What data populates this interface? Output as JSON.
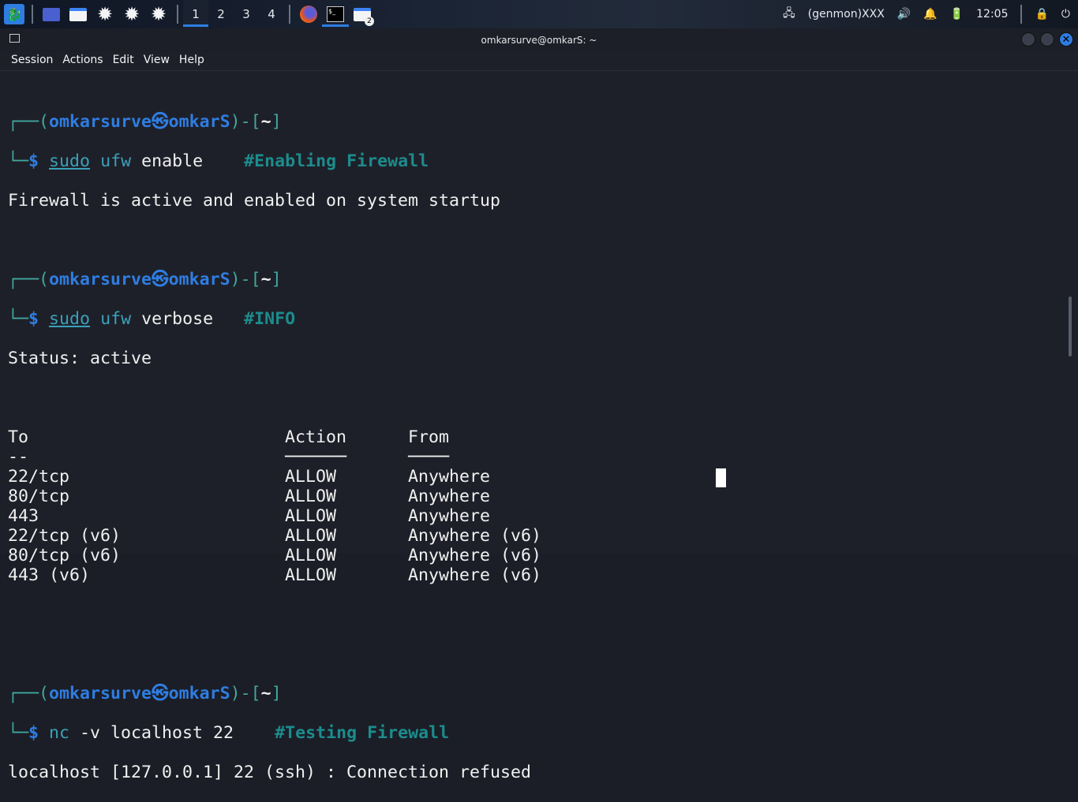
{
  "panel": {
    "workspaces": [
      "1",
      "2",
      "3",
      "4"
    ],
    "genmon": "(genmon)XXX",
    "clock": "12:05",
    "badge": "2"
  },
  "window": {
    "title": "omkarsurve@omkarS: ~",
    "menu": [
      "Session",
      "Actions",
      "Edit",
      "View",
      "Help"
    ]
  },
  "prompt": {
    "user": "omkarsurve",
    "at": "㉿",
    "host": "omkarS",
    "dir": "~"
  },
  "commands": [
    {
      "sudo": "sudo",
      "cmd": "ufw",
      "args": " enable    ",
      "comment": "#Enabling Firewall",
      "output": [
        "Firewall is active and enabled on system startup"
      ]
    },
    {
      "sudo": "sudo",
      "cmd": "ufw",
      "args": " verbose   ",
      "comment": "#INFO",
      "output": [
        "Status: active"
      ]
    },
    {
      "cmd": "nc",
      "args": " -v localhost 22    ",
      "comment": "#Testing Firewall",
      "output": [
        "localhost [127.0.0.1] 22 (ssh) : Connection refused"
      ]
    }
  ],
  "table": {
    "headers": [
      "To",
      "Action",
      "From"
    ],
    "underline": [
      "--",
      "──────",
      "────"
    ],
    "rows": [
      [
        "22/tcp",
        "ALLOW",
        "Anywhere"
      ],
      [
        "80/tcp",
        "ALLOW",
        "Anywhere"
      ],
      [
        "443",
        "ALLOW",
        "Anywhere"
      ],
      [
        "22/tcp (v6)",
        "ALLOW",
        "Anywhere (v6)"
      ],
      [
        "80/tcp (v6)",
        "ALLOW",
        "Anywhere (v6)"
      ],
      [
        "443 (v6)",
        "ALLOW",
        "Anywhere (v6)"
      ]
    ]
  }
}
